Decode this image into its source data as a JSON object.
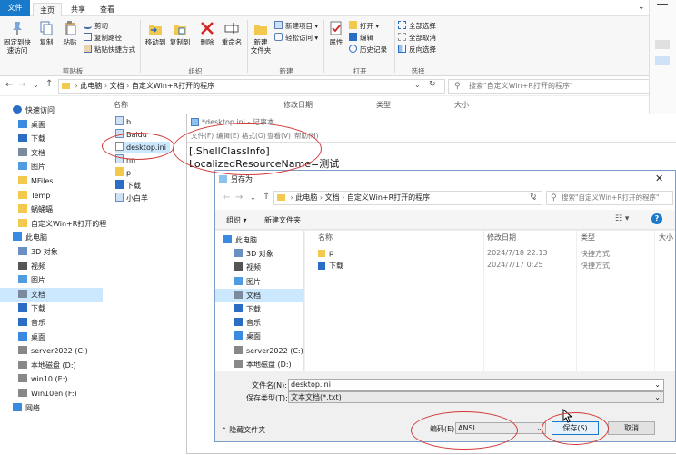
{
  "ribbon": {
    "tabs": [
      "文件",
      "主页",
      "共享",
      "查看"
    ],
    "clipboard": {
      "pin": "固定到快速访问",
      "copy": "复制",
      "paste": "粘贴",
      "cut": "剪切",
      "copy_path": "复制路径",
      "paste_shortcut": "粘贴快捷方式",
      "group": "剪贴板"
    },
    "organize": {
      "move_to": "移动到",
      "copy_to": "复制到",
      "delete": "删除",
      "rename": "重命名",
      "group": "组织"
    },
    "new": {
      "new_folder": "新建\n文件夹",
      "new_item": "新建项目",
      "easy_access": "轻松访问",
      "group": "新建"
    },
    "open": {
      "properties": "属性",
      "open": "打开",
      "edit": "编辑",
      "history": "历史记录",
      "group": "打开"
    },
    "select": {
      "select_all": "全部选择",
      "select_none": "全部取消",
      "invert": "反向选择",
      "group": "选择"
    }
  },
  "address": {
    "path": [
      "此电脑",
      "文档",
      "自定义Win+R打开的程序"
    ],
    "search_placeholder": "搜索\"自定义Win+R打开的程序\""
  },
  "nav": {
    "items": [
      {
        "label": "快速访问",
        "icon": "star-icon",
        "level": 0
      },
      {
        "label": "桌面",
        "icon": "desktop-icon",
        "level": 1
      },
      {
        "label": "下载",
        "icon": "download-icon",
        "level": 1
      },
      {
        "label": "文档",
        "icon": "document-icon",
        "level": 1
      },
      {
        "label": "图片",
        "icon": "picture-icon",
        "level": 1
      },
      {
        "label": "MFiles",
        "icon": "folder-icon",
        "level": 1
      },
      {
        "label": "Temp",
        "icon": "folder-icon",
        "level": 1
      },
      {
        "label": "蜗蛹蝠",
        "icon": "folder-icon",
        "level": 1
      },
      {
        "label": "自定义Win+R打开的程",
        "icon": "folder-icon",
        "level": 1
      },
      {
        "label": "此电脑",
        "icon": "computer-icon",
        "level": 0
      },
      {
        "label": "3D 对象",
        "icon": "cube-icon",
        "level": 1
      },
      {
        "label": "视频",
        "icon": "video-icon",
        "level": 1
      },
      {
        "label": "图片",
        "icon": "picture-icon",
        "level": 1
      },
      {
        "label": "文档",
        "icon": "document-icon",
        "level": 1
      },
      {
        "label": "下载",
        "icon": "download-icon",
        "level": 1
      },
      {
        "label": "音乐",
        "icon": "music-icon",
        "level": 1
      },
      {
        "label": "桌面",
        "icon": "desktop-icon",
        "level": 1
      },
      {
        "label": "server2022 (C:)",
        "icon": "drive-icon",
        "level": 1
      },
      {
        "label": "本地磁盘 (D:)",
        "icon": "drive-icon",
        "level": 1
      },
      {
        "label": "win10 (E:)",
        "icon": "drive-icon",
        "level": 1
      },
      {
        "label": "Win10en (F:)",
        "icon": "drive-icon",
        "level": 1
      },
      {
        "label": "网络",
        "icon": "network-icon",
        "level": 0
      }
    ]
  },
  "list": {
    "headers": [
      "名称",
      "修改日期",
      "类型",
      "大小"
    ],
    "files": [
      "b",
      "Baidu",
      "desktop.ini",
      "nn",
      "p",
      "下载",
      "小白羊"
    ]
  },
  "notepad": {
    "title": "*desktop.ini - 记事本",
    "menu": [
      "文件(F)",
      "编辑(E)",
      "格式(O)",
      "查看(V)",
      "帮助(H)"
    ],
    "lines": [
      "[.ShellClassInfo]",
      "LocalizedResourceName=测试"
    ]
  },
  "dialog": {
    "title": "另存为",
    "path": [
      "此电脑",
      "文档",
      "自定义Win+R打开的程序"
    ],
    "search_placeholder": "搜索\"自定义Win+R打开的程序\"",
    "organize": "组织",
    "new_folder": "新建文件夹",
    "headers": [
      "名称",
      "修改日期",
      "类型",
      "大小"
    ],
    "nav": [
      "此电脑",
      "3D 对象",
      "视频",
      "图片",
      "文档",
      "下载",
      "音乐",
      "桌面",
      "server2022 (C:)",
      "本地磁盘 (D:)"
    ],
    "files": [
      {
        "name": "p",
        "date": "2024/7/18 22:13",
        "type": "快捷方式"
      },
      {
        "name": "下载",
        "date": "2024/7/17 0:25",
        "type": "快捷方式"
      }
    ],
    "filename_label": "文件名(N):",
    "filename": "desktop.ini",
    "filetype_label": "保存类型(T):",
    "filetype": "文本文档(*.txt)",
    "hide_folders": "隐藏文件夹",
    "encoding_label": "编码(E):",
    "encoding": "ANSI",
    "save": "保存(S)",
    "cancel": "取消"
  },
  "colors": {
    "accent": "#1979ca",
    "selection": "#cce8ff",
    "annotation": "#d23a3a",
    "folder": "#f2c94c"
  }
}
